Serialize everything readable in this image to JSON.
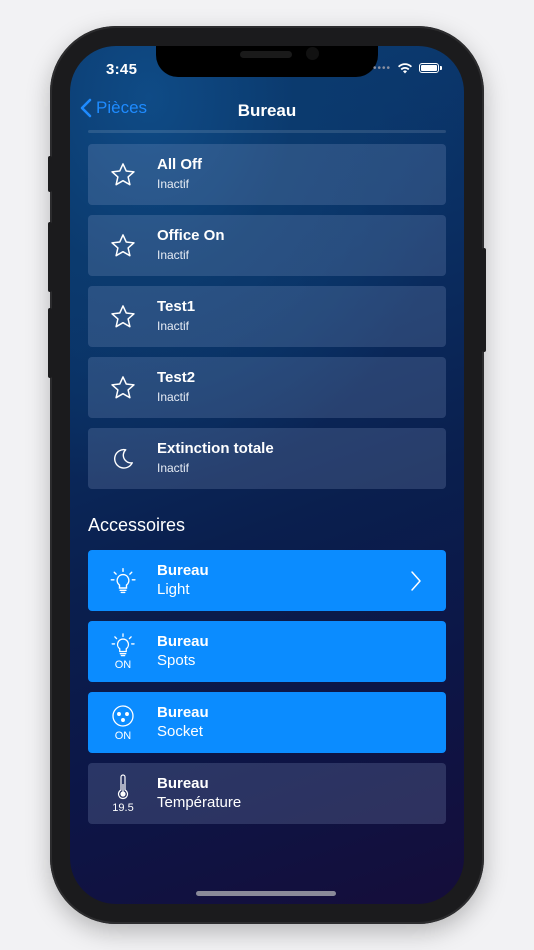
{
  "status_bar": {
    "time": "3:45",
    "signal_dots": "•••• "
  },
  "nav": {
    "back_label": "Pièces",
    "title": "Bureau"
  },
  "scenes": [
    {
      "title": "All Off",
      "subtitle": "Inactif",
      "icon": "star-icon"
    },
    {
      "title": "Office On",
      "subtitle": "Inactif",
      "icon": "star-icon"
    },
    {
      "title": "Test1",
      "subtitle": "Inactif",
      "icon": "star-icon"
    },
    {
      "title": "Test2",
      "subtitle": "Inactif",
      "icon": "star-icon"
    },
    {
      "title": "Extinction totale",
      "subtitle": "Inactif",
      "icon": "moon-icon"
    }
  ],
  "accessories_header": "Accessoires",
  "accessories": [
    {
      "title": "Bureau",
      "subtitle": "Light",
      "icon": "bulb-icon",
      "state": "",
      "active": true,
      "chevron": true
    },
    {
      "title": "Bureau",
      "subtitle": "Spots",
      "icon": "bulb-icon",
      "state": "ON",
      "active": true
    },
    {
      "title": "Bureau",
      "subtitle": "Socket",
      "icon": "socket-icon",
      "state": "ON",
      "active": true
    },
    {
      "title": "Bureau",
      "subtitle": "Température",
      "icon": "thermometer-icon",
      "state": "19.5",
      "active": false
    }
  ],
  "colors": {
    "accent": "#1e8bff",
    "active_card": "#0b8cff"
  }
}
